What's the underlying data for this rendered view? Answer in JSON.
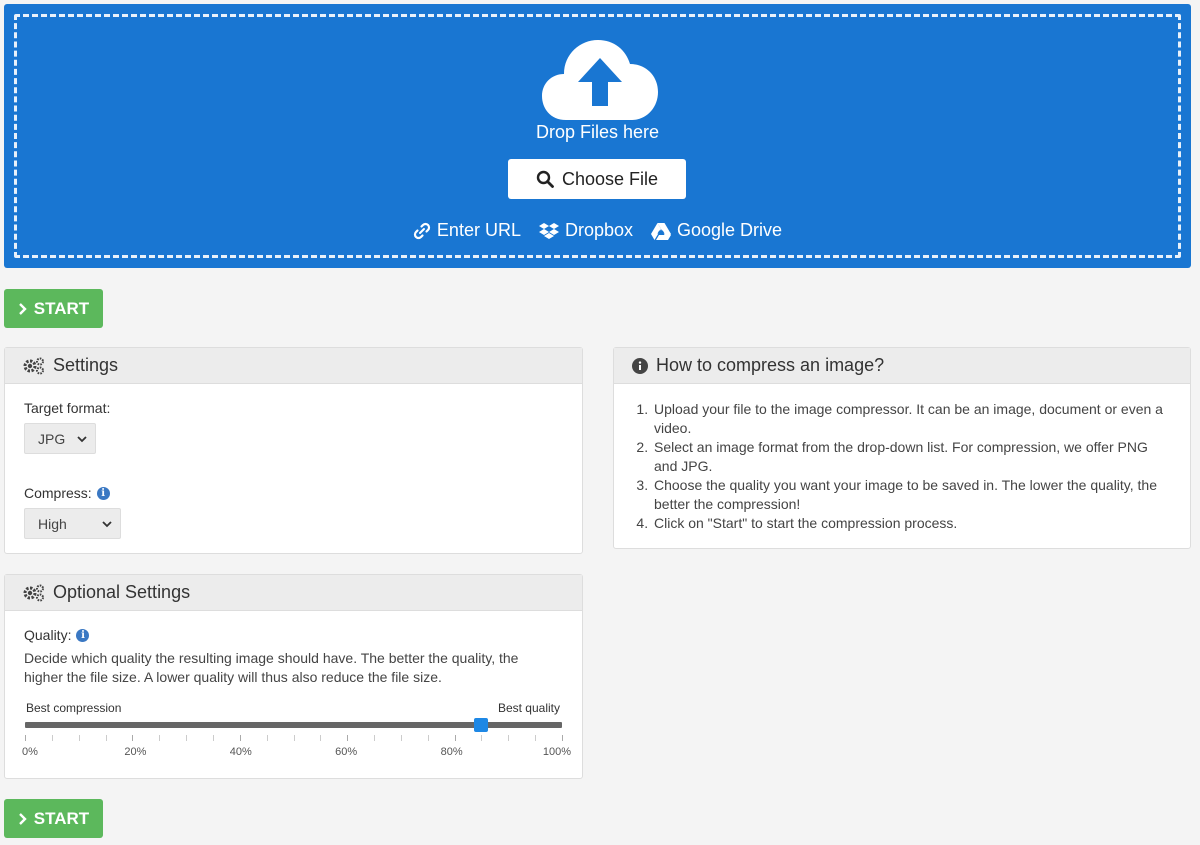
{
  "upload": {
    "drop_text": "Drop Files here",
    "choose_file_label": "Choose File",
    "sources": [
      {
        "label": "Enter URL",
        "icon": "link-icon"
      },
      {
        "label": "Dropbox",
        "icon": "dropbox-icon"
      },
      {
        "label": "Google Drive",
        "icon": "google-drive-icon"
      }
    ],
    "accent_color": "#1976d2"
  },
  "start_button": {
    "label": "START",
    "color": "#5cb85c"
  },
  "settings": {
    "title": "Settings",
    "target_format_label": "Target format:",
    "target_format_value": "JPG",
    "compress_label": "Compress:",
    "compress_value": "High"
  },
  "optional_settings": {
    "title": "Optional Settings",
    "quality_label": "Quality:",
    "quality_description": "Decide which quality the resulting image should have. The better the quality, the higher the file size. A lower quality will thus also reduce the file size.",
    "min_label": "Best compression",
    "max_label": "Best quality",
    "quality_value": 85,
    "tick_labels": [
      "0%",
      "20%",
      "40%",
      "60%",
      "80%",
      "100%"
    ]
  },
  "howto": {
    "title": "How to compress an image?",
    "steps": [
      "Upload your file to the image compressor. It can be an image, document or even a video.",
      "Select an image format from the drop-down list. For compression, we offer PNG and JPG.",
      "Choose the quality you want your image to be saved in. The lower the quality, the better the compression!",
      "Click on \"Start\" to start the compression process."
    ]
  }
}
